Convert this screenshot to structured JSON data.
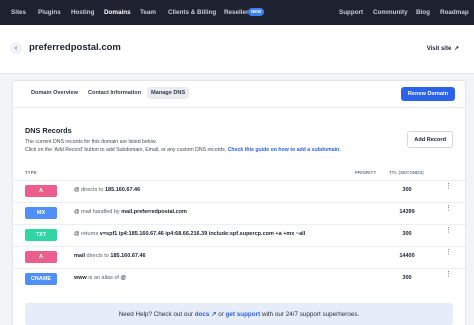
{
  "topnav": {
    "left": [
      "Sites",
      "Plugins",
      "Hosting",
      "Domains",
      "Team",
      "Clients & Billing",
      "Reseller"
    ],
    "new_badge": "NEW",
    "right": [
      "Support",
      "Community",
      "Blog",
      "Roadmap"
    ],
    "active": "Domains"
  },
  "header": {
    "back_icon": "‹",
    "domain": "preferredpostal.com",
    "visit_site": "Visit site",
    "visit_icon": "↗"
  },
  "tabs": [
    "Domain Overview",
    "Contact Information",
    "Manage DNS"
  ],
  "active_tab": "Manage DNS",
  "renew_button": "Renew Domain",
  "dns": {
    "title": "DNS Records",
    "desc_line1": "The current DNS records for this domain are listed below.",
    "desc_line2_prefix": "Click on the 'Add Record' button to add Subdomain, Email, or any custom DNS records.",
    "desc_line2_link": "Check this guide on how to add a subdomain.",
    "add_record": "Add Record",
    "columns": {
      "type": "TYPE",
      "priority": "PRIORITY",
      "ttl": "TTL (SECONDS)"
    },
    "records": [
      {
        "type": "A",
        "color": "#ec5f8c",
        "name": "@",
        "connector": "directs to",
        "value": "185.160.67.46",
        "ttl": "300"
      },
      {
        "type": "MX",
        "color": "#4f8ff7",
        "name": "@",
        "connector": "mail handled by",
        "value": "mail.preferredpostal.com",
        "ttl": "14399"
      },
      {
        "type": "TXT",
        "color": "#2fd6a3",
        "name": "@",
        "connector": "returns",
        "value": "v=spf1 ip4:185.160.67.46 ip4:68.66.216.39 include:spf.supercp.com +a +mx ~all",
        "ttl": "300"
      },
      {
        "type": "A",
        "color": "#ec5f8c",
        "name": "mail",
        "connector": "directs to",
        "value": "185.160.67.46",
        "ttl": "14400"
      },
      {
        "type": "CNAME",
        "color": "#4f8ff7",
        "name": "www",
        "connector": "is an alias of",
        "value": "@",
        "ttl": "300"
      }
    ],
    "menu_icon": "⋮"
  },
  "help": {
    "prefix": "Need Help? Check out our",
    "docs": "docs",
    "docs_icon": "↗",
    "middle": "or",
    "support": "get support",
    "suffix": "with our 24/7 support superheroes."
  }
}
